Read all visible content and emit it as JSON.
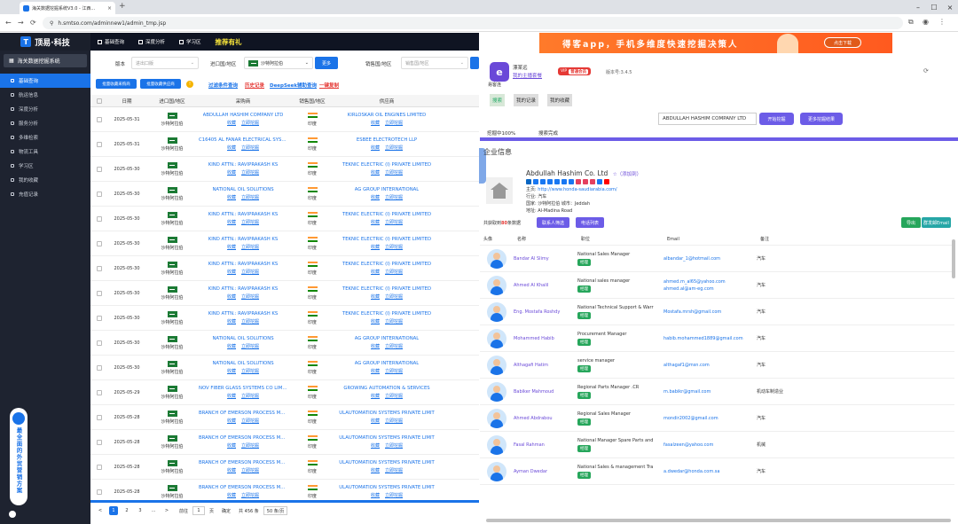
{
  "browser": {
    "tab_title": "海关数据挖掘系统V3.0 - 江西...",
    "url": "h.smtso.com/adminnew1/admin_tmp.jsp"
  },
  "sidebar": {
    "logo": "顶易·科技",
    "system_title": "海关数据挖掘系统",
    "items": [
      {
        "label": "基础查询",
        "active": true
      },
      {
        "label": "航运信息"
      },
      {
        "label": "深度分析"
      },
      {
        "label": "服务分析"
      },
      {
        "label": "多维检索"
      },
      {
        "label": "物流工具"
      },
      {
        "label": "学习区"
      },
      {
        "label": "我的收藏"
      },
      {
        "label": "充值记录"
      }
    ],
    "ad_text": "最全面的外贸营销方案"
  },
  "topnav": {
    "items": [
      "基础查询",
      "深度分析",
      "学习区"
    ],
    "highlight": "推荐有礼"
  },
  "filters": {
    "version_label": "版本",
    "version_placeholder": "进出口版",
    "country_label": "进口国/地区",
    "country_value": "沙特阿拉伯",
    "more_btn": "更多",
    "sales_label": "销售国/地区",
    "sales_placeholder": "销售国/地区"
  },
  "actions": {
    "btn1": "批量收藏采购商",
    "btn2": "批量收藏供应商",
    "warn": "!",
    "link1": "过滤条件查询",
    "link2": "历史记录",
    "link3": "DeepSeek辅助查询",
    "link4": "一键复制"
  },
  "table": {
    "headers": [
      "",
      "日期",
      "进口国/地区",
      "采购商",
      "销售国/地区",
      "供应商"
    ],
    "op_collect": "收藏",
    "op_dig": "立即挖掘",
    "rows": [
      {
        "date": "2025-05-31",
        "import": "沙特阿拉伯",
        "buyer": "ABDULLAH HASHIM COMPANY LTD",
        "sales": "印度",
        "supplier": "KIRLOSKAR OIL ENGINES LIMITED"
      },
      {
        "date": "2025-05-31",
        "import": "沙特阿拉伯",
        "buyer": "C16405 AL FANAR ELECTRICAL SYSTEMS",
        "sales": "印度",
        "supplier": "ESBEE ELECTROTECH LLP"
      },
      {
        "date": "2025-05-30",
        "import": "沙特阿拉伯",
        "buyer": "KIND ATTN.: RAVIPRAKASH KS",
        "sales": "印度",
        "supplier": "TEKNIC ELECTRIC (I) PRIVATE LIMITED"
      },
      {
        "date": "2025-05-30",
        "import": "沙特阿拉伯",
        "buyer": "NATIONAL OIL SOLUTIONS",
        "sales": "印度",
        "supplier": "AG GROUP INTERNATIONAL"
      },
      {
        "date": "2025-05-30",
        "import": "沙特阿拉伯",
        "buyer": "KIND ATTN.: RAVIPRAKASH KS",
        "sales": "印度",
        "supplier": "TEKNIC ELECTRIC (I) PRIVATE LIMITED"
      },
      {
        "date": "2025-05-30",
        "import": "沙特阿拉伯",
        "buyer": "KIND ATTN.: RAVIPRAKASH KS",
        "sales": "印度",
        "supplier": "TEKNIC ELECTRIC (I) PRIVATE LIMITED"
      },
      {
        "date": "2025-05-30",
        "import": "沙特阿拉伯",
        "buyer": "KIND ATTN.: RAVIPRAKASH KS",
        "sales": "印度",
        "supplier": "TEKNIC ELECTRIC (I) PRIVATE LIMITED"
      },
      {
        "date": "2025-05-30",
        "import": "沙特阿拉伯",
        "buyer": "KIND ATTN.: RAVIPRAKASH KS",
        "sales": "印度",
        "supplier": "TEKNIC ELECTRIC (I) PRIVATE LIMITED"
      },
      {
        "date": "2025-05-30",
        "import": "沙特阿拉伯",
        "buyer": "KIND ATTN.: RAVIPRAKASH KS",
        "sales": "印度",
        "supplier": "TEKNIC ELECTRIC (I) PRIVATE LIMITED"
      },
      {
        "date": "2025-05-30",
        "import": "沙特阿拉伯",
        "buyer": "NATIONAL OIL SOLUTIONS",
        "sales": "印度",
        "supplier": "AG GROUP INTERNATIONAL"
      },
      {
        "date": "2025-05-30",
        "import": "沙特阿拉伯",
        "buyer": "NATIONAL OIL SOLUTIONS",
        "sales": "印度",
        "supplier": "AG GROUP INTERNATIONAL"
      },
      {
        "date": "2025-05-29",
        "import": "沙特阿拉伯",
        "buyer": "NOV FIBER GLASS SYSTEMS CO LIMITED",
        "sales": "印度",
        "supplier": "GROWING AUTOMATION & SERVICES"
      },
      {
        "date": "2025-05-28",
        "import": "沙特阿拉伯",
        "buyer": "BRANCH OF EMERSON PROCESS MANAG",
        "sales": "印度",
        "supplier": "ULAUTOMATION SYSTEMS PRIVATE LIMIT"
      },
      {
        "date": "2025-05-28",
        "import": "沙特阿拉伯",
        "buyer": "BRANCH OF EMERSON PROCESS MANAG",
        "sales": "印度",
        "supplier": "ULAUTOMATION SYSTEMS PRIVATE LIMIT"
      },
      {
        "date": "2025-05-28",
        "import": "沙特阿拉伯",
        "buyer": "BRANCH OF EMERSON PROCESS MANAG",
        "sales": "印度",
        "supplier": "ULAUTOMATION SYSTEMS PRIVATE LIMIT"
      },
      {
        "date": "2025-05-28",
        "import": "沙特阿拉伯",
        "buyer": "BRANCH OF EMERSON PROCESS MANAG",
        "sales": "印度",
        "supplier": "ULAUTOMATION SYSTEMS PRIVATE LIMIT"
      }
    ]
  },
  "pager": {
    "prev": "<",
    "pages": [
      "1",
      "2",
      "3",
      "...",
      ">"
    ],
    "goto_label": "前往",
    "goto_value": "1",
    "page_unit": "页",
    "confirm": "确定",
    "total": "共 456 条",
    "per_page": "50 条/页"
  },
  "plugin": {
    "banner": "得客app，手机多维度快速挖掘决策人",
    "banner_btn": "点击下载",
    "logo_text": "易客连",
    "logo_letter": "e",
    "user": "漂某远",
    "link": "我的主播套餐",
    "vip_label": "VIP",
    "vip_badge": "普通会员",
    "version": "版本号:3.4.5",
    "refresh_icon": "⟳",
    "tabs": [
      "搜索",
      "我的记录",
      "我的收藏"
    ],
    "search_value": "ABDULLAH HASHIM COMPANY LTD",
    "btn_dig": "开始挖掘",
    "btn_more": "更多挖掘结果",
    "progress_label": "挖掘中100%",
    "progress_status": "搜索完成",
    "progress": 1.0,
    "section_title": "企业信息",
    "company": {
      "name": "Abdullah Hashim Co. Ltd",
      "fav": "☆（添加到）",
      "homepage_label": "主页:",
      "homepage": "http://www.honda-saudiarabia.com/",
      "industry_label": "行业:",
      "industry": "汽车",
      "country_label": "国家:",
      "country": "沙特阿拉伯 城市：Jeddah",
      "address_label": "地址:",
      "address": "Al-Madina Road"
    },
    "social_colors": [
      "#0a66c2",
      "#1877f2",
      "#1877f2",
      "#1877f2",
      "#1877f2",
      "#1877f2",
      "#1877f2",
      "#e4405f",
      "#e4405f",
      "#e4405f",
      "#1877f2",
      "#ff0000"
    ],
    "summary_prefix": "共获取到",
    "summary_count": "80",
    "summary_suffix": "条数据",
    "btn_contact": "联系人筛选",
    "btn_email": "电话列表",
    "btn_export": "导出",
    "btn_bulk_email": "群发邮Email",
    "contact_headers": [
      "头像",
      "名称",
      "职位",
      "Email",
      "备注"
    ],
    "contacts": [
      {
        "name": "Bandar Al Slimy",
        "title": "National Sales Manager",
        "tag": "经理",
        "email": "albandar_1@hotmail.com",
        "note": "汽车"
      },
      {
        "name": "Ahmed Al Khalil",
        "title": "National sales manager",
        "tag": "经理",
        "email": "ahmed.m_al65@yahoo.com\nahmed.al@am-eg.com",
        "note": "汽车"
      },
      {
        "name": "Eng. Mostafa Roshdy",
        "title": "National Technical Support & Warr",
        "tag": "经理",
        "email": "Mostafa.mrsh@gmail.com",
        "note": "汽车"
      },
      {
        "name": "Mohammed Habib",
        "title": "Procurement Manager",
        "tag": "经理",
        "email": "habib.mohammed1889@gmail.com",
        "note": "汽车"
      },
      {
        "name": "Althagafi Hatim",
        "title": "service manager",
        "tag": "经理",
        "email": "althagaf1@msn.com",
        "note": "汽车"
      },
      {
        "name": "Babiker Mahmoud",
        "title": "Regional Parts Manager .CR",
        "tag": "经理",
        "email": "m.babikr@gmail.com",
        "note": "机动车制造业"
      },
      {
        "name": "Ahmed Abdrabou",
        "title": "Regional Sales Manager",
        "tag": "经理",
        "email": "mondir2002@gmail.com",
        "note": "汽车"
      },
      {
        "name": "Fasal Rahman",
        "title": "National Manager Spare Parts and",
        "tag": "经理",
        "email": "fasalzeen@yahoo.com",
        "note": "机械"
      },
      {
        "name": "Ayman Dwedar",
        "title": "National Sales & management Tra",
        "tag": "经理",
        "email": "a.dwedar@honda.com.sa",
        "note": "汽车"
      }
    ]
  }
}
